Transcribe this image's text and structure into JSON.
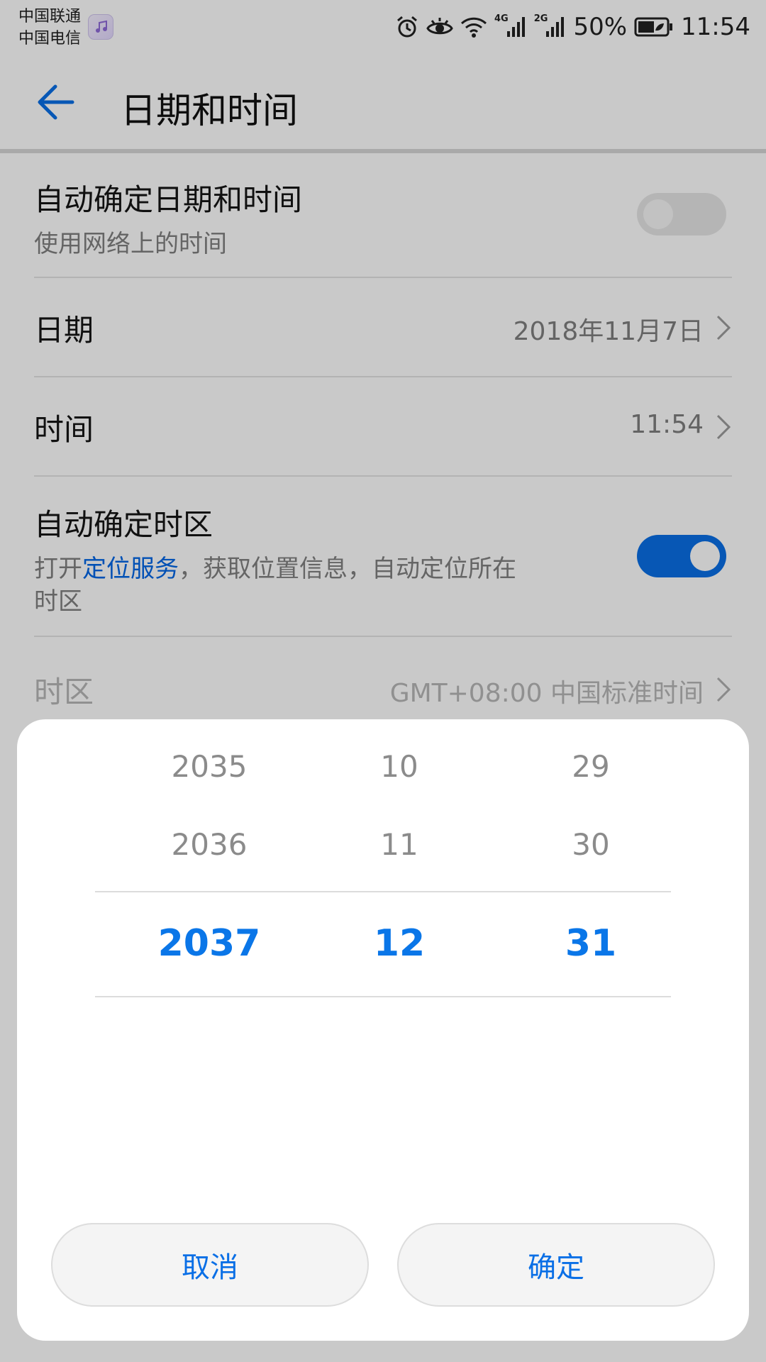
{
  "status_bar": {
    "carrier_1": "中国联通",
    "carrier_2": "中国电信",
    "net_1": "4G",
    "net_2": "2G",
    "battery_pct": "50%",
    "time": "11:54",
    "icons": [
      "music-app-icon",
      "alarm-icon",
      "eye-comfort-icon",
      "wifi-icon",
      "signal-icon",
      "battery-icon"
    ]
  },
  "app_bar": {
    "title": "日期和时间"
  },
  "settings": {
    "auto_datetime": {
      "title": "自动确定日期和时间",
      "subtitle": "使用网络上的时间",
      "enabled": false
    },
    "date": {
      "label": "日期",
      "value": "2018年11月7日"
    },
    "time": {
      "label": "时间",
      "value": "11:54"
    },
    "auto_timezone": {
      "title": "自动确定时区",
      "sub_prefix": "打开",
      "sub_link": "定位服务",
      "sub_suffix": "，获取位置信息，自动定位所在",
      "sub_line2": "时区",
      "enabled": true
    },
    "timezone": {
      "label": "时区",
      "value": "GMT+08:00 中国标准时间"
    }
  },
  "date_picker": {
    "years": [
      "2035",
      "2036",
      "2037"
    ],
    "months": [
      "10",
      "11",
      "12"
    ],
    "days": [
      "29",
      "30",
      "31"
    ],
    "selected": {
      "year": "2037",
      "month": "12",
      "day": "31"
    },
    "cancel_label": "取消",
    "confirm_label": "确定"
  },
  "colors": {
    "accent": "#0a6fe6",
    "scrim": "rgba(0,0,0,0.21)"
  }
}
